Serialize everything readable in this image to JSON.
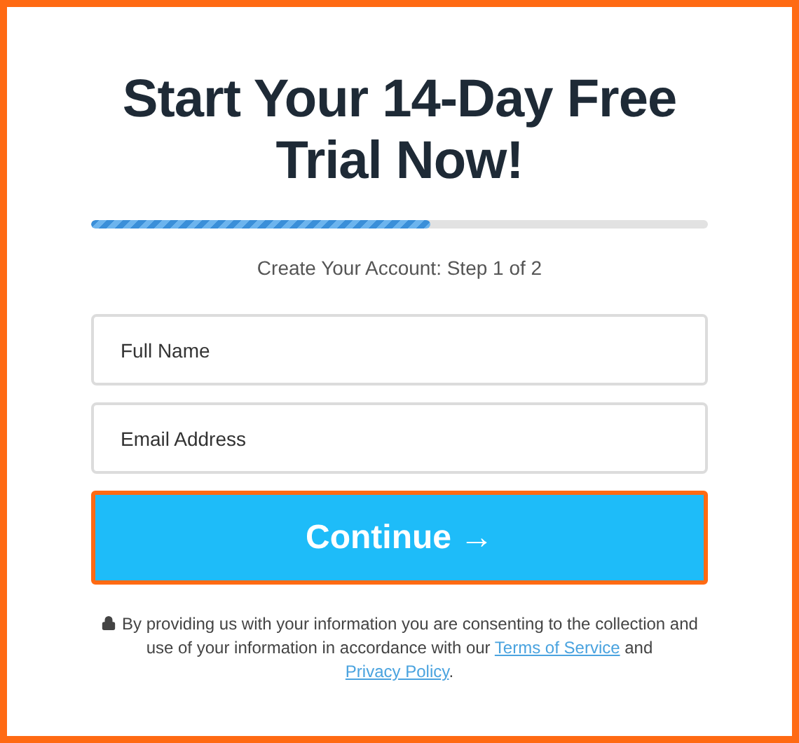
{
  "title": "Start Your 14-Day Free Trial Now!",
  "progress": {
    "level": 0.55
  },
  "step": "Create Your Account: Step 1 of 2",
  "fields": [
    {
      "placeholder": "Full Name"
    },
    {
      "placeholder": "Email Address"
    }
  ],
  "continue_button": {
    "label": "Continue",
    "arrow": "→"
  },
  "consent": {
    "text": "By providing us with your information you are consenting to the collection and use of your information in accordance with our",
    "terms_link": "Terms of Service",
    "and": "and",
    "privacy_link": "Privacy Policy",
    "end": "."
  }
}
